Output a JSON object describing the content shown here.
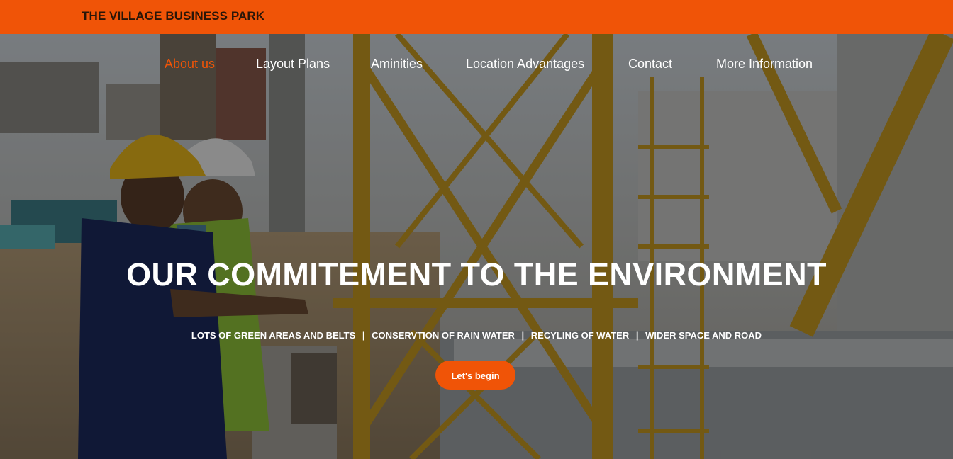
{
  "brand": "THE VILLAGE BUSINESS PARK",
  "nav": {
    "items": [
      {
        "label": "About us",
        "active": true
      },
      {
        "label": "Layout Plans",
        "active": false
      },
      {
        "label": "Aminities",
        "active": false
      },
      {
        "label": "Location Advantages",
        "active": false
      },
      {
        "label": "Contact",
        "active": false
      },
      {
        "label": "More Information",
        "active": false
      }
    ]
  },
  "hero": {
    "headline": "OUR COMMITEMENT TO THE ENVIRONMENT",
    "features": [
      "LOTS OF GREEN AREAS AND BELTS",
      "CONSERVTION OF RAIN WATER",
      "RECYLING OF WATER",
      "WIDER SPACE AND ROAD"
    ],
    "separator": "|",
    "cta_label": "Let's begin"
  },
  "colors": {
    "accent": "#f05407",
    "brand_text": "#2a1608",
    "overlay": "rgba(0,0,0,0.42)"
  }
}
